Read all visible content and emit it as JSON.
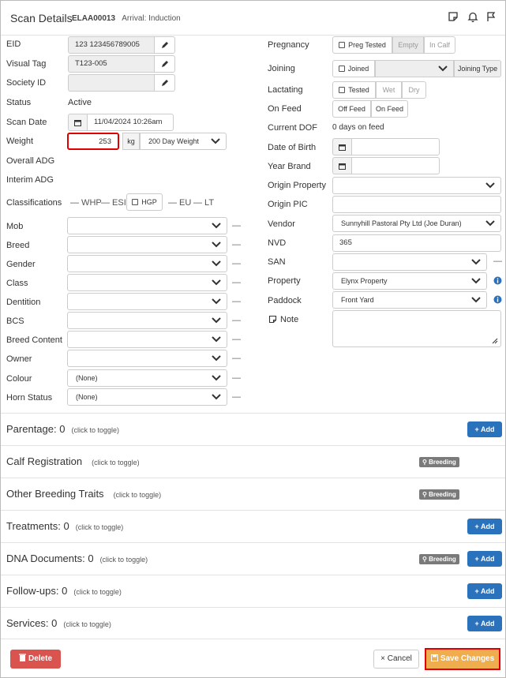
{
  "header": {
    "title": "Scan Details",
    "animal_id": "ELAA00013",
    "arrival": "Arrival: Induction"
  },
  "left": {
    "eid_label": "EID",
    "eid_value": "123 123456789005",
    "visual_tag_label": "Visual Tag",
    "visual_tag_value": "T123-005",
    "society_id_label": "Society ID",
    "society_id_value": "",
    "status_label": "Status",
    "status_value": "Active",
    "scan_date_label": "Scan Date",
    "scan_date_value": "11/04/2024 10:26am",
    "weight_label": "Weight",
    "weight_value": "253",
    "weight_unit": "kg",
    "weight_type": "200 Day Weight",
    "overall_adg_label": "Overall ADG",
    "interim_adg_label": "Interim ADG",
    "classifications_label": "Classifications",
    "class_whp": "— WHP",
    "class_esi": "— ESI",
    "class_hgp": "HGP",
    "class_eu": "— EU",
    "class_lt": "— LT",
    "mob_label": "Mob",
    "breed_label": "Breed",
    "gender_label": "Gender",
    "class_label": "Class",
    "dentition_label": "Dentition",
    "bcs_label": "BCS",
    "breed_content_label": "Breed Content",
    "owner_label": "Owner",
    "colour_label": "Colour",
    "colour_value": "(None)",
    "horn_status_label": "Horn Status",
    "horn_status_value": "(None)",
    "dash": "—"
  },
  "right": {
    "pregnancy_label": "Pregnancy",
    "preg_tested": "Preg Tested",
    "empty": "Empty",
    "in_calf": "In Calf",
    "joining_label": "Joining",
    "joined": "Joined",
    "joining_type": "Joining Type",
    "lactating_label": "Lactating",
    "tested": "Tested",
    "wet": "Wet",
    "dry": "Dry",
    "on_feed_label": "On Feed",
    "off_feed": "Off Feed",
    "on_feed": "On Feed",
    "current_dof_label": "Current DOF",
    "current_dof_value": "0 days on feed",
    "dob_label": "Date of Birth",
    "year_brand_label": "Year Brand",
    "origin_property_label": "Origin Property",
    "origin_pic_label": "Origin PIC",
    "vendor_label": "Vendor",
    "vendor_value": "Sunnyhill Pastoral Pty Ltd (Joe Duran)",
    "nvd_label": "NVD",
    "nvd_value": "365",
    "san_label": "SAN",
    "property_label": "Property",
    "property_value": "Elynx Property",
    "paddock_label": "Paddock",
    "paddock_value": "Front Yard",
    "note_label": "Note",
    "dash": "—"
  },
  "sections": [
    {
      "title": "Parentage:",
      "count": "0",
      "hint": "(click to toggle)",
      "action": "+ Add"
    },
    {
      "title": "Calf Registration",
      "count": "",
      "hint": "(click to toggle)",
      "badge": "Breeding"
    },
    {
      "title": "Other Breeding Traits",
      "count": "",
      "hint": "(click to toggle)",
      "badge": "Breeding"
    },
    {
      "title": "Treatments:",
      "count": "0",
      "hint": "(click to toggle)",
      "action": "+ Add"
    },
    {
      "title": "DNA Documents:",
      "count": "0",
      "hint": "(click to toggle)",
      "badge": "Breeding",
      "action": "+ Add"
    },
    {
      "title": "Follow-ups:",
      "count": "0",
      "hint": "(click to toggle)",
      "action": "+ Add"
    },
    {
      "title": "Services:",
      "count": "0",
      "hint": "(click to toggle)",
      "action": "+ Add"
    }
  ],
  "footer": {
    "delete_label": "Delete",
    "cancel_label": "× Cancel",
    "save_label": "Save Changes"
  },
  "colors": {
    "primary": "#2a72bb",
    "danger": "#d9534f",
    "warning": "#f0ad4e",
    "highlight": "#e00000"
  }
}
